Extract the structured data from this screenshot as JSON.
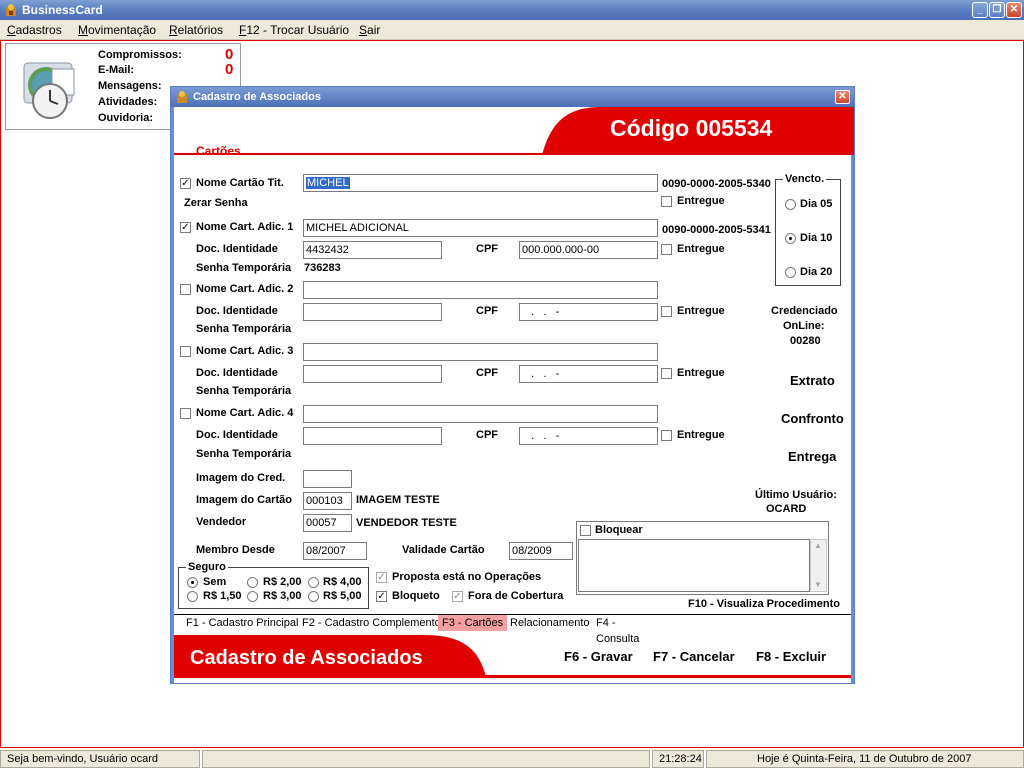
{
  "window": {
    "title": "BusinessCard"
  },
  "menu": {
    "items": [
      {
        "label": "Cadastros",
        "mnemonic": "C",
        "rest": "adastros"
      },
      {
        "label": "Movimentação",
        "mnemonic": "M",
        "rest": "ovimentação"
      },
      {
        "label": "Relatórios",
        "mnemonic": "R",
        "rest": "elatórios"
      },
      {
        "label": "F12 - Trocar Usuário",
        "mnemonic": "F",
        "rest": "12 - Trocar Usuário"
      },
      {
        "label": "Sair",
        "mnemonic": "S",
        "rest": "air"
      }
    ]
  },
  "info": {
    "compromissos_label": "Compromissos:",
    "compromissos_value": "0",
    "email_label": "E-Mail:",
    "email_value": "0",
    "mensagens_label": "Mensagens:",
    "atividades_label": "Atividades:",
    "ouvidoria_label": "Ouvidoria:"
  },
  "dialog": {
    "title": "Cadastro de Associados",
    "codigo": "Código 005534",
    "section": "Cartões",
    "titular": {
      "label": "Nome Cartão Tit.",
      "value": "MICHEL",
      "card_number": "0090-0000-2005-5340",
      "checked": "✓"
    },
    "zerar_senha": "Zerar Senha",
    "entregue_label": "Entregue",
    "adic1": {
      "label": "Nome Cart. Adic. 1",
      "value": "MICHEL ADICIONAL",
      "card_number": "0090-0000-2005-5341",
      "doc": "4432432",
      "cpf": "000.000.000-00",
      "senha": "736283",
      "checked": "✓"
    },
    "adic2": {
      "label": "Nome Cart. Adic. 2",
      "cpf": "   .   .   -"
    },
    "adic3": {
      "label": "Nome Cart. Adic. 3",
      "cpf": "   .   .   -"
    },
    "adic4": {
      "label": "Nome Cart. Adic. 4",
      "cpf": "   .   .   -"
    },
    "doc_label": "Doc. Identidade",
    "cpf_label": "CPF",
    "senha_label": "Senha Temporária",
    "vencto": {
      "label": "Vencto.",
      "opt1": "Dia 05",
      "opt2": "Dia 10",
      "opt3": "Dia 20",
      "selected": "Dia 10"
    },
    "credenciado": {
      "line1": "Credenciado",
      "line2": "OnLine:",
      "code": "00280"
    },
    "links": {
      "extrato": "Extrato",
      "confronto": "Confronto",
      "entrega": "Entrega"
    },
    "imagem_cred_label": "Imagem do Cred.",
    "imagem_cartao": {
      "label": "Imagem do Cartão",
      "code": "000103",
      "desc": "IMAGEM TESTE"
    },
    "vendedor": {
      "label": "Vendedor",
      "code": "00057",
      "desc": "VENDEDOR TESTE"
    },
    "ultimo_usuario": {
      "label": "Último Usuário:",
      "value": "OCARD"
    },
    "bloquear_label": "Bloquear",
    "membro_desde": {
      "label": "Membro Desde",
      "value": "08/2007"
    },
    "validade": {
      "label": "Validade Cartão",
      "value": "08/2009"
    },
    "seguro": {
      "label": "Seguro",
      "sem": "Sem",
      "o200": "R$ 2,00",
      "o400": "R$ 4,00",
      "o150": "R$ 1,50",
      "o300": "R$ 3,00",
      "o500": "R$ 5,00"
    },
    "proposta_label": "Proposta está no Operações",
    "bloqueto_label": "Bloqueto",
    "fora_label": "Fora de Cobertura",
    "f10_label": "F10 - Visualiza Procedimento",
    "tabs": {
      "t1": "F1 - Cadastro Principal",
      "t2": "F2 - Cadastro Complemento",
      "t3": "F3 - Cartões",
      "t4": "Relacionamento",
      "t5": "F4 - Consulta"
    },
    "footer_title": "Cadastro de Associados",
    "actions": {
      "gravar": "F6 - Gravar",
      "cancelar": "F7 - Cancelar",
      "excluir": "F8 - Excluir"
    }
  },
  "status": {
    "welcome": "Seja bem-vindo, Usuário ocard",
    "time": "21:28:24",
    "date": "Hoje é Quinta-Feira, 11 de Outubro de 2007"
  },
  "colors": {
    "accent_red": "#e00000",
    "title_blue": "#4c70b8"
  }
}
